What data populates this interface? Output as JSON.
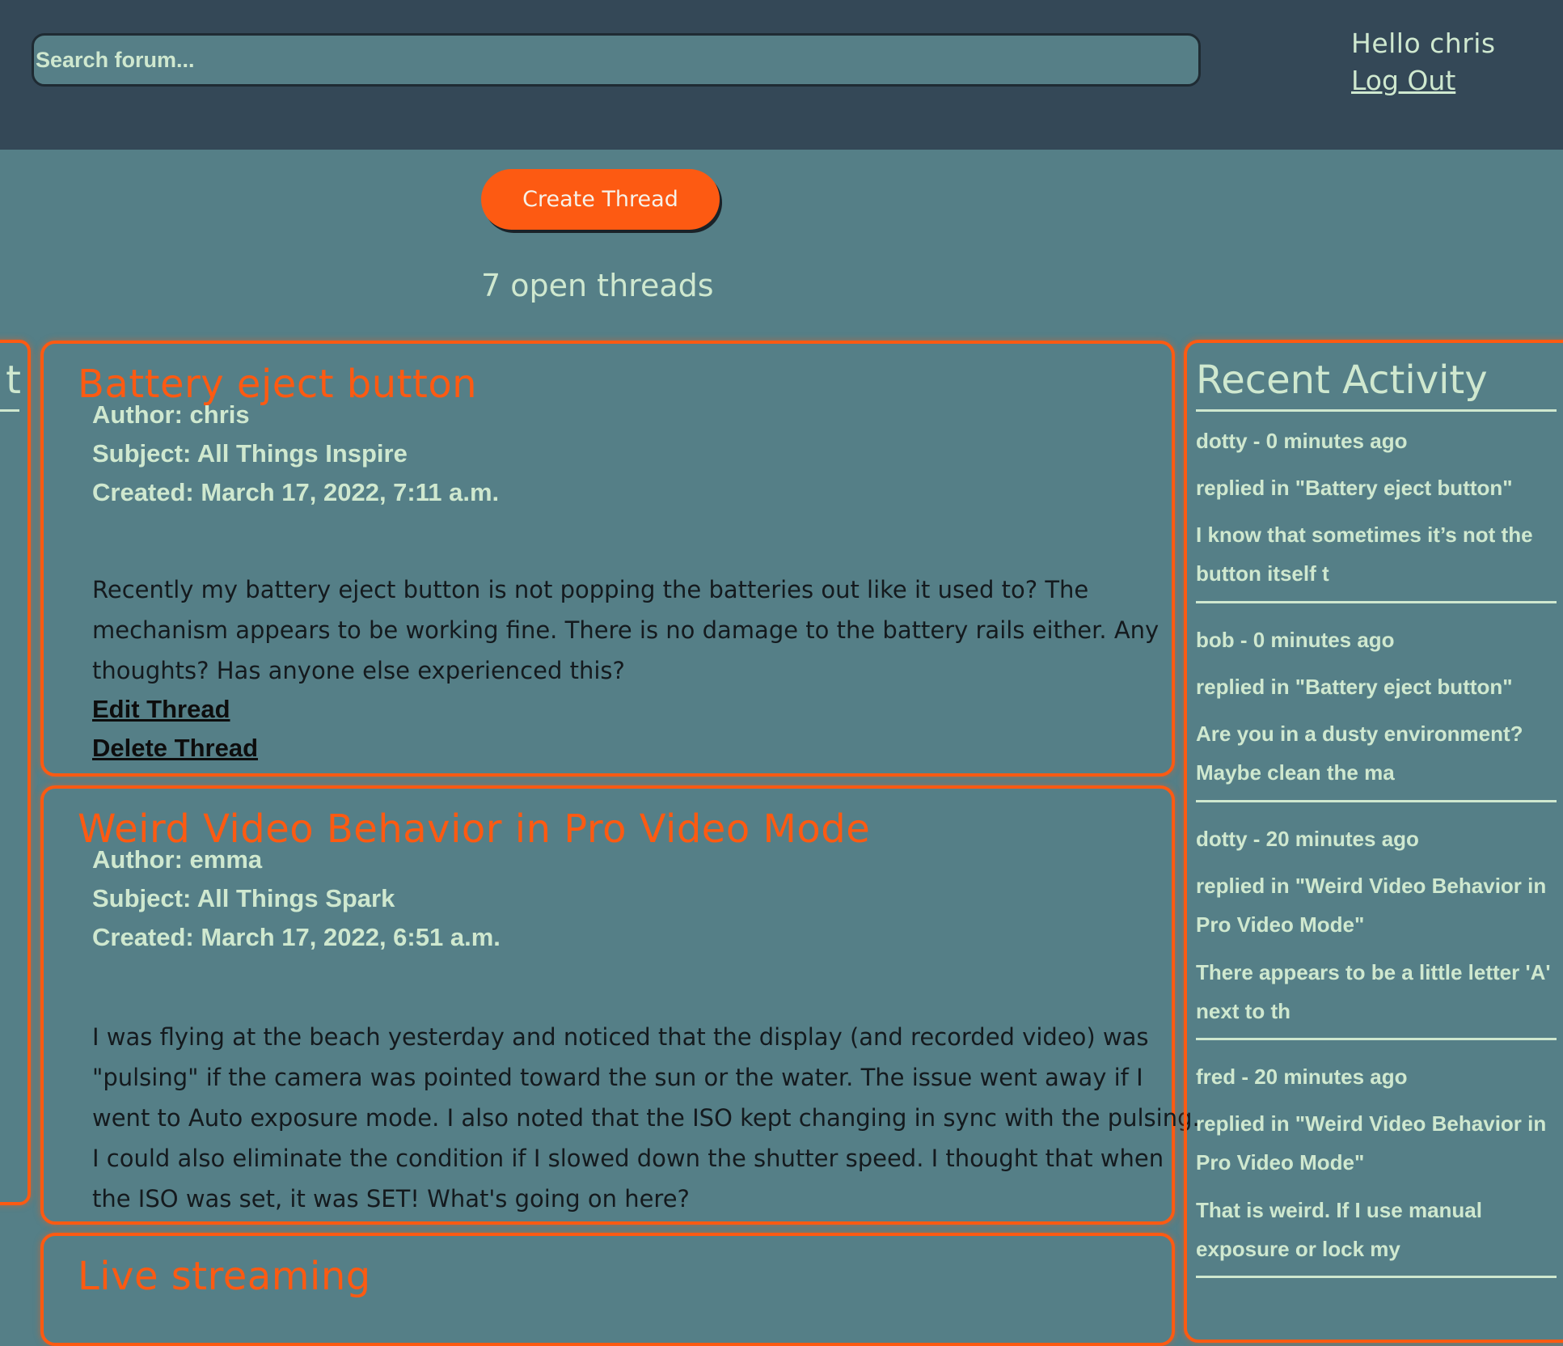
{
  "header": {
    "search_placeholder": "Search forum...",
    "greeting": "Hello chris",
    "logout_label": "Log Out"
  },
  "main": {
    "create_thread_label": "Create Thread",
    "open_threads_text": "7 open threads",
    "left_panel_title": "t"
  },
  "threads": [
    {
      "title": "Battery eject button",
      "author": "Author: chris",
      "subject": "Subject: All Things Inspire",
      "created": "Created: March 17, 2022, 7:11 a.m.",
      "body": "Recently my battery eject button is not popping the batteries out like it used to? The mechanism appears to be working fine. There is no damage to the battery rails either. Any thoughts? Has anyone else experienced this?",
      "edit_label": "Edit Thread",
      "delete_label": "Delete Thread"
    },
    {
      "title": "Weird Video Behavior in Pro Video Mode",
      "author": "Author: emma",
      "subject": "Subject: All Things Spark",
      "created": "Created: March 17, 2022, 6:51 a.m.",
      "body": "I was flying at the beach yesterday and noticed that the display (and recorded video) was \"pulsing\" if the camera was pointed toward the sun or the water. The issue went away if I went to Auto exposure mode. I also noted that the ISO kept changing in sync with the pulsing. I could also eliminate the condition if I slowed down the shutter speed. I thought that when the ISO was set, it was SET! What's going on here?"
    },
    {
      "title": "Live streaming"
    }
  ],
  "activity": {
    "title": "Recent Activity",
    "items": [
      {
        "who": "dotty - 0 minutes ago",
        "where": "replied in \"Battery eject button\"",
        "snippet": "I know that sometimes it’s not the button itself t"
      },
      {
        "who": "bob - 0 minutes ago",
        "where": "replied in \"Battery eject button\"",
        "snippet": "Are you in a dusty environment? Maybe clean the ma"
      },
      {
        "who": "dotty - 20 minutes ago",
        "where": "replied in \"Weird Video Behavior in Pro Video Mode\"",
        "snippet": "There appears to be a little letter 'A' next to th"
      },
      {
        "who": "fred - 20 minutes ago",
        "where": "replied in \"Weird Video Behavior in Pro Video Mode\"",
        "snippet": "That is weird. If I use manual exposure or lock my"
      }
    ]
  },
  "colors": {
    "background": "#557f87",
    "header_bg": "#344857",
    "accent": "#fd5a12",
    "text_light": "#cfe8cf",
    "text_dark": "#141a1e"
  }
}
